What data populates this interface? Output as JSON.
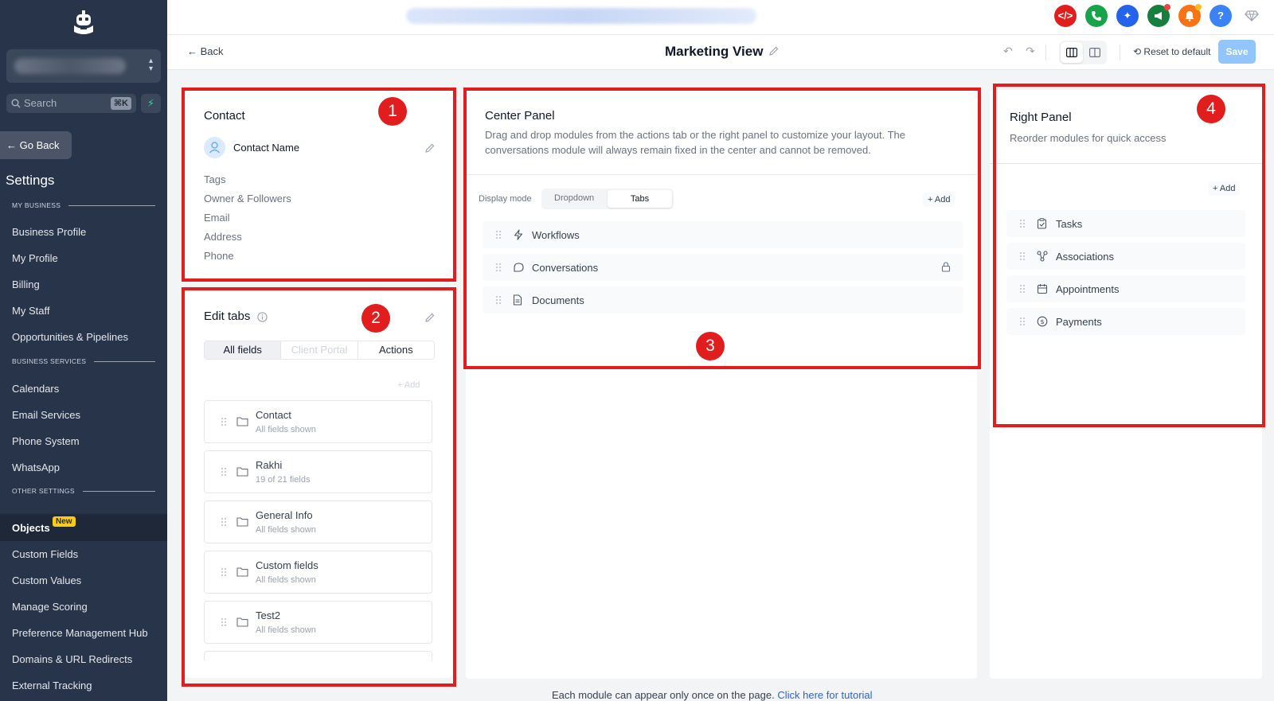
{
  "sidebar": {
    "search_placeholder": "Search",
    "search_shortcut": "⌘K",
    "go_back": "Go Back",
    "settings_title": "Settings",
    "sections": {
      "my_business": "MY BUSINESS",
      "business_services": "BUSINESS SERVICES",
      "other_settings": "OTHER SETTINGS"
    },
    "my_business_items": [
      "Business Profile",
      "My Profile",
      "Billing",
      "My Staff",
      "Opportunities & Pipelines"
    ],
    "business_services_items": [
      "Calendars",
      "Email Services",
      "Phone System",
      "WhatsApp"
    ],
    "objects_label": "Objects",
    "objects_badge": "New",
    "other_items": [
      "Custom Fields",
      "Custom Values",
      "Manage Scoring",
      "Preference Management Hub",
      "Domains & URL Redirects",
      "External Tracking"
    ]
  },
  "topbar": {
    "icons": [
      "code-icon",
      "phone-icon",
      "sparkle-icon",
      "megaphone-icon",
      "bell-icon",
      "help-icon",
      "diamond-icon"
    ],
    "help_label": "?",
    "colors": {
      "code": "#e11d1d",
      "phone": "#16a34a",
      "sparkle": "#2563eb",
      "megaphone": "#15803d",
      "bell": "#f97316",
      "help": "#3b82f6"
    }
  },
  "header": {
    "back": "Back",
    "title": "Marketing View",
    "reset": "Reset to default",
    "save": "Save"
  },
  "contact_panel": {
    "title": "Contact",
    "name": "Contact Name",
    "fields": [
      "Tags",
      "Owner & Followers",
      "Email",
      "Address",
      "Phone"
    ]
  },
  "edit_tabs": {
    "title": "Edit tabs",
    "tabs": [
      "All fields",
      "Client Portal",
      "Actions"
    ],
    "add": "Add",
    "items": [
      {
        "name": "Contact",
        "sub": "All fields shown"
      },
      {
        "name": "Rakhi",
        "sub": "19 of 21 fields"
      },
      {
        "name": "General Info",
        "sub": "All fields shown"
      },
      {
        "name": "Custom fields",
        "sub": "All fields shown"
      },
      {
        "name": "Test2",
        "sub": "All fields shown"
      }
    ]
  },
  "center_panel": {
    "title": "Center Panel",
    "description_line1": "Drag and drop modules from the actions tab or the right panel to customize your layout. The",
    "description_line2": "conversations module will always remain fixed in the center and cannot be removed.",
    "display_mode_label": "Display mode",
    "modes": [
      "Dropdown",
      "Tabs"
    ],
    "add": "Add",
    "modules": [
      "Workflows",
      "Conversations",
      "Documents"
    ]
  },
  "right_panel": {
    "title": "Right Panel",
    "description": "Reorder modules for quick access",
    "add": "Add",
    "modules": [
      "Tasks",
      "Associations",
      "Appointments",
      "Payments"
    ]
  },
  "markers": [
    "1",
    "2",
    "3",
    "4"
  ],
  "footer": {
    "note": "Each module can appear only once on the page.",
    "link": "Click here for tutorial"
  }
}
